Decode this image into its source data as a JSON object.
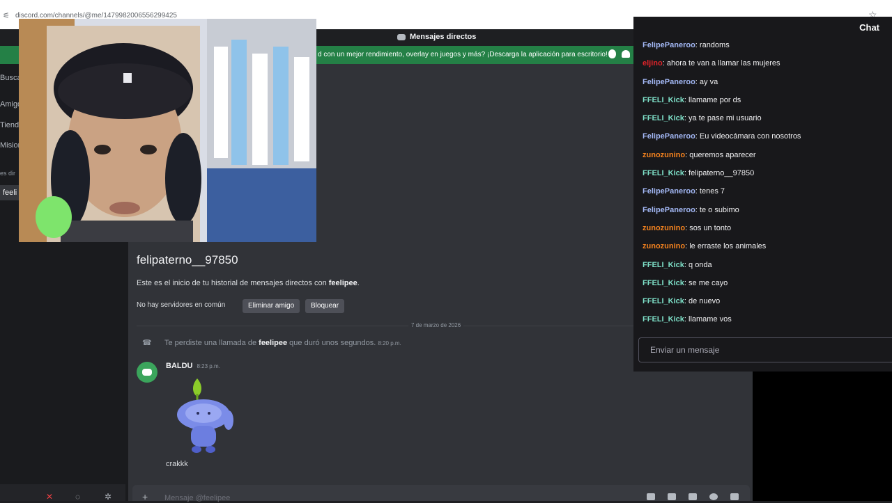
{
  "browser": {
    "url": "discord.com/channels/@me/1479982006556299425"
  },
  "discord": {
    "header_title": "Mensajes directos",
    "notice_text": "d con un mejor rendimiento, overlay en juegos y más? ¡Descarga la aplicación para escritorio!",
    "sidebar": {
      "search": "Buscar",
      "items": [
        "Amigo",
        "Tienda",
        "Mision",
        "es dir",
        "feeli"
      ]
    },
    "profile": {
      "display_name": "feelipee",
      "username": "felipaterno__97850",
      "intro_prefix": "Este es el inicio de tu historial de mensajes directos con ",
      "intro_name": "feelipee",
      "intro_suffix": ".",
      "no_servers": "No hay servidores en común",
      "remove_friend": "Eliminar amigo",
      "block": "Bloquear"
    },
    "date_divider": "7 de marzo de 2026",
    "missed_call": {
      "prefix": "Te perdiste una llamada de ",
      "name": "feelipee",
      "suffix": " que duró unos segundos.",
      "time": "8:20 p.m."
    },
    "message": {
      "author": "BALDU",
      "time": "8:23 p.m.",
      "text": "crakkk"
    },
    "composer_placeholder": "Mensaje @feelipee"
  },
  "chat": {
    "title": "Chat",
    "send_placeholder": "Enviar un mensaje",
    "messages": [
      {
        "user": "FelipePaneroo",
        "color": "#a3b8f5",
        "text": ": randoms"
      },
      {
        "user": "eljino",
        "color": "#e0242a",
        "text": ": ahora te van a llamar las mujeres"
      },
      {
        "user": "FelipePaneroo",
        "color": "#a3b8f5",
        "text": ": ay va"
      },
      {
        "user": "FFELI_Kick",
        "color": "#7ee0c8",
        "text": ": llamame por ds"
      },
      {
        "user": "FFELI_Kick",
        "color": "#7ee0c8",
        "text": ": ya te pase mi usuario"
      },
      {
        "user": "FelipePaneroo",
        "color": "#a3b8f5",
        "text": ": Eu videocámara con nosotros"
      },
      {
        "user": "zunozunino",
        "color": "#f5831f",
        "text": ": queremos aparecer"
      },
      {
        "user": "FFELI_Kick",
        "color": "#7ee0c8",
        "text": ": felipaterno__97850"
      },
      {
        "user": "FelipePaneroo",
        "color": "#a3b8f5",
        "text": ": tenes 7"
      },
      {
        "user": "FelipePaneroo",
        "color": "#a3b8f5",
        "text": ": te o subimo"
      },
      {
        "user": "zunozunino",
        "color": "#f5831f",
        "text": ": sos un tonto"
      },
      {
        "user": "zunozunino",
        "color": "#f5831f",
        "text": ": le erraste los animales"
      },
      {
        "user": "FFELI_Kick",
        "color": "#7ee0c8",
        "text": ": q onda"
      },
      {
        "user": "FFELI_Kick",
        "color": "#7ee0c8",
        "text": ": se me cayo"
      },
      {
        "user": "FFELI_Kick",
        "color": "#7ee0c8",
        "text": ": de nuevo"
      },
      {
        "user": "FFELI_Kick",
        "color": "#7ee0c8",
        "text": ": llamame vos"
      }
    ]
  },
  "icons": {
    "mic": "mic-muted-icon",
    "headset": "headset-icon",
    "settings": "gear-icon",
    "add": "plus-icon",
    "gift": "gift-icon",
    "gif": "gif-icon",
    "sticker": "sticker-icon",
    "emoji": "emoji-icon",
    "apps": "apps-icon"
  }
}
